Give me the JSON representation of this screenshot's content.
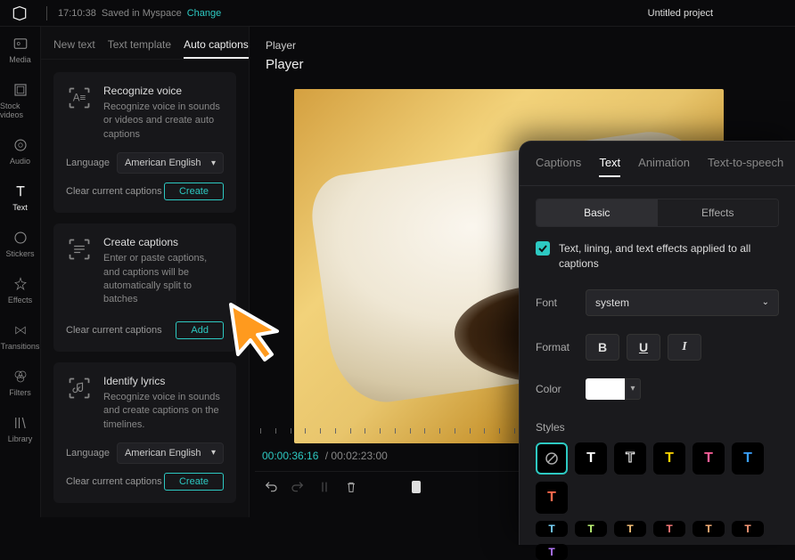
{
  "topbar": {
    "time": "17:10:38",
    "saved_label": "Saved in Myspace",
    "change_label": "Change",
    "project_title": "Untitled project"
  },
  "sidenav": {
    "items": [
      {
        "label": "Media"
      },
      {
        "label": "Stock videos"
      },
      {
        "label": "Audio"
      },
      {
        "label": "Text"
      },
      {
        "label": "Stickers"
      },
      {
        "label": "Effects"
      },
      {
        "label": "Transitions"
      },
      {
        "label": "Filters"
      },
      {
        "label": "Library"
      }
    ]
  },
  "leftpanel": {
    "tabs": {
      "new_text": "New text",
      "text_template": "Text template",
      "auto_captions": "Auto captions"
    },
    "card1": {
      "title": "Recognize voice",
      "desc": "Recognize voice in sounds or videos and create auto captions",
      "lang_label": "Language",
      "lang_value": "American English",
      "clear": "Clear current captions",
      "btn": "Create"
    },
    "card2": {
      "title": "Create captions",
      "desc": "Enter or paste captions, and captions will be automatically split to batches",
      "clear": "Clear current captions",
      "btn": "Add"
    },
    "card3": {
      "title": "Identify lyrics",
      "desc": "Recognize voice in sounds and create captions on the timelines.",
      "lang_label": "Language",
      "lang_value": "American English",
      "clear": "Clear current captions",
      "btn": "Create"
    }
  },
  "player": {
    "tab": "Player",
    "title": "Player",
    "current": "00:00:36:16",
    "total": "00:02:23:00"
  },
  "inspector": {
    "tabs": {
      "captions": "Captions",
      "text": "Text",
      "animation": "Animation",
      "tts": "Text-to-speech"
    },
    "subtabs": {
      "basic": "Basic",
      "effects": "Effects"
    },
    "apply_all": "Text, lining, and text effects applied to all captions",
    "font_label": "Font",
    "font_value": "system",
    "format_label": "Format",
    "color_label": "Color",
    "styles_label": "Styles",
    "style_letters": [
      "∅",
      "T",
      "T",
      "T",
      "T",
      "T",
      "T"
    ],
    "style_colors": [
      "none",
      "#fff",
      "#fff-outline",
      "#ffd400",
      "#ff5f9a",
      "#3aa0ff",
      "#ff6a4d"
    ]
  }
}
